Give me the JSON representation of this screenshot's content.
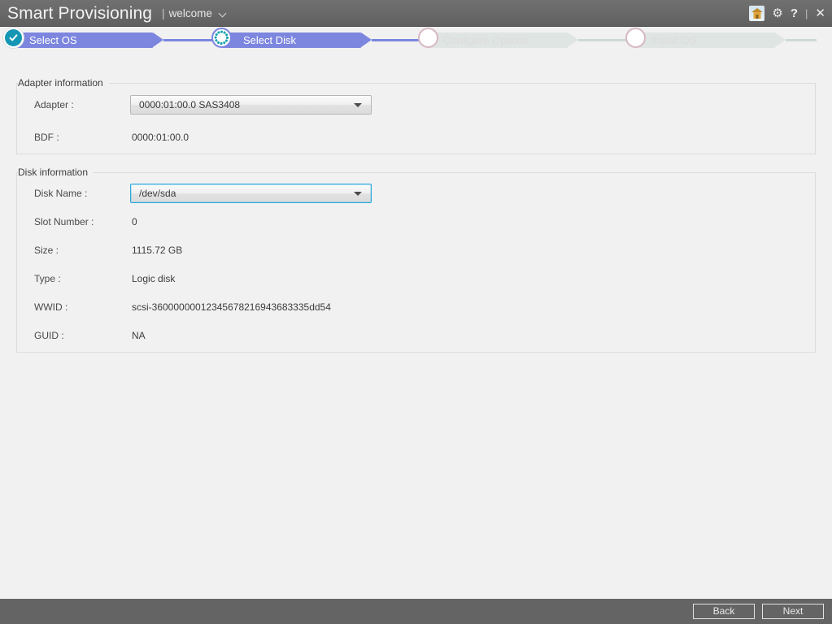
{
  "titlebar": {
    "app_title": "Smart Provisioning",
    "pipe": "|",
    "user_label": "welcome",
    "icons": {
      "home": "home-icon",
      "gear": "⚙",
      "help": "?",
      "separator": "|",
      "close": "✕"
    }
  },
  "stepper": {
    "steps": [
      {
        "label": "Select OS",
        "state": "done"
      },
      {
        "label": "Select Disk",
        "state": "active"
      },
      {
        "label": "Configure Options",
        "state": "idle"
      },
      {
        "label": "Install OS",
        "state": "idle"
      }
    ],
    "colors": {
      "active_bar": "#7c86df",
      "idle_bar": "#dfe5e2",
      "done_circle": "#1596b4",
      "idle_circle_border": "#d8b8c6"
    }
  },
  "adapter_section": {
    "title": "Adapter information",
    "adapter_label": "Adapter :",
    "adapter_value": "0000:01:00.0  SAS3408",
    "bdf_label": "BDF :",
    "bdf_value": "0000:01:00.0"
  },
  "disk_section": {
    "title": "Disk information",
    "disk_name_label": "Disk Name :",
    "disk_name_value": "/dev/sda",
    "slot_number_label": "Slot Number :",
    "slot_number_value": "0",
    "size_label": "Size :",
    "size_value": "1115.72 GB",
    "type_label": "Type :",
    "type_value": "Logic disk",
    "wwid_label": "WWID :",
    "wwid_value": "scsi-36000000012345678216943683335dd54",
    "guid_label": "GUID :",
    "guid_value": "NA"
  },
  "footer": {
    "back_label": "Back",
    "next_label": "Next"
  }
}
